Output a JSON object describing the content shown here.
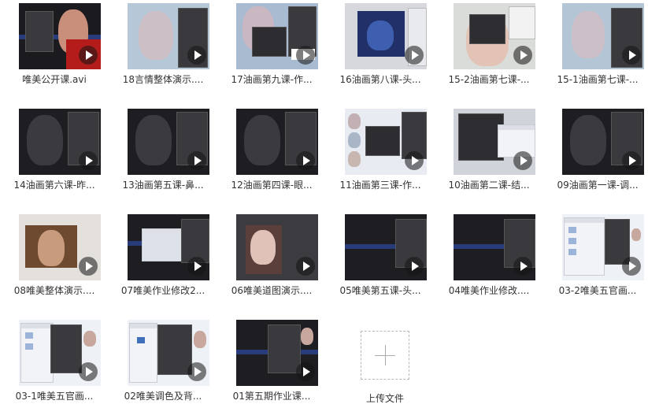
{
  "files": [
    {
      "name": "唯美公开课.avi"
    },
    {
      "name": "18言情整体演示...."
    },
    {
      "name": "17油画第九课-作..."
    },
    {
      "name": "16油画第八课-头..."
    },
    {
      "name": "15-2油画第七课-..."
    },
    {
      "name": "15-1油画第七课-..."
    },
    {
      "name": "14油画第六课-昨..."
    },
    {
      "name": "13油画第五课-鼻..."
    },
    {
      "name": "12油画第四课-眼..."
    },
    {
      "name": "11油画第三课-作..."
    },
    {
      "name": "10油画第二课-结..."
    },
    {
      "name": "09油画第一课-调..."
    },
    {
      "name": "08唯美整体演示...."
    },
    {
      "name": "07唯美作业修改2..."
    },
    {
      "name": "06唯美道图演示...."
    },
    {
      "name": "05唯美第五课-头..."
    },
    {
      "name": "04唯美作业修改...."
    },
    {
      "name": "03-2唯美五官画..."
    },
    {
      "name": "03-1唯美五官画..."
    },
    {
      "name": "02唯美调色及背..."
    },
    {
      "name": "01第五期作业课..."
    }
  ],
  "upload": {
    "label": "上传文件",
    "icon": "plus-icon"
  },
  "colors": {
    "thumb_bg": "#1e1e22",
    "accent_band": "#283b7a",
    "text": "#333333"
  }
}
